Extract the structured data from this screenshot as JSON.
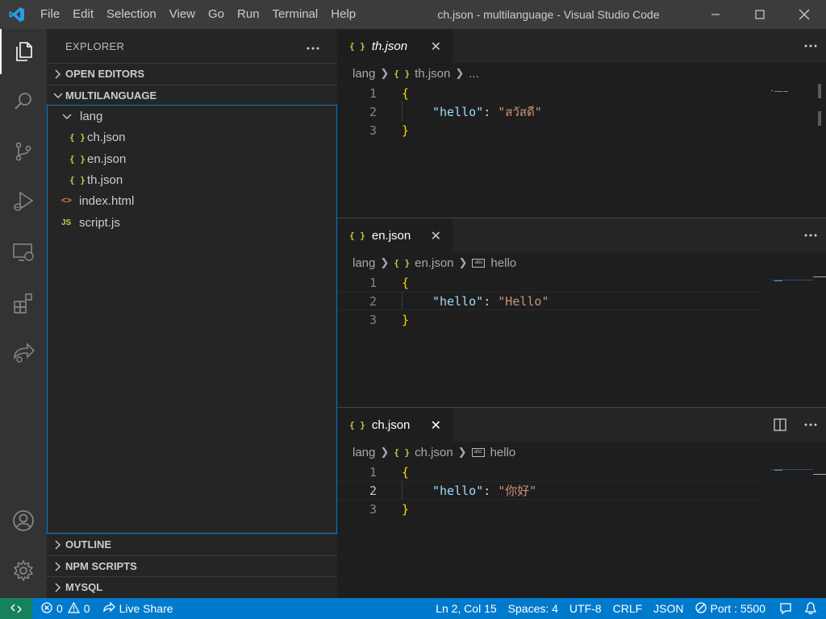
{
  "window": {
    "title": "ch.json - multilanguage - Visual Studio Code",
    "menu": [
      "File",
      "Edit",
      "Selection",
      "View",
      "Go",
      "Run",
      "Terminal",
      "Help"
    ]
  },
  "sidebar": {
    "header": "EXPLORER",
    "sections": {
      "open_editors": "OPEN EDITORS",
      "project": "MULTILANGUAGE",
      "outline": "OUTLINE",
      "npm_scripts": "NPM SCRIPTS",
      "mysql": "MYSQL"
    },
    "tree": {
      "folder": "lang",
      "lang_files": [
        "ch.json",
        "en.json",
        "th.json"
      ],
      "root_files": [
        "index.html",
        "script.js"
      ],
      "icon_json": "{ }",
      "icon_html": "<>",
      "icon_js": "JS"
    }
  },
  "editors": [
    {
      "tab": "th.json",
      "active": false,
      "breadcrumb": [
        "lang",
        "th.json",
        "..."
      ],
      "line_numbers": [
        "1",
        "2",
        "3"
      ],
      "lines": {
        "l1": "{",
        "key": "\"hello\"",
        "colon": ": ",
        "value": "\"สวัสดี\"",
        "l3": "}"
      }
    },
    {
      "tab": "en.json",
      "active": false,
      "breadcrumb": [
        "lang",
        "en.json",
        "hello"
      ],
      "line_numbers": [
        "1",
        "2",
        "3"
      ],
      "lines": {
        "l1": "{",
        "key": "\"hello\"",
        "colon": ": ",
        "value": "\"Hello\"",
        "l3": "}"
      }
    },
    {
      "tab": "ch.json",
      "active": true,
      "breadcrumb": [
        "lang",
        "ch.json",
        "hello"
      ],
      "line_numbers": [
        "1",
        "2",
        "3"
      ],
      "lines": {
        "l1": "{",
        "key": "\"hello\"",
        "colon": ": ",
        "value": "\"你好\"",
        "l3": "}"
      }
    }
  ],
  "statusbar": {
    "errors": "0",
    "warnings": "0",
    "live_share": "Live Share",
    "cursor": "Ln 2, Col 15",
    "spaces": "Spaces: 4",
    "encoding": "UTF-8",
    "eol": "CRLF",
    "language": "JSON",
    "port": "Port : 5500"
  },
  "colors": {
    "accent": "#007acc",
    "remote": "#16825d",
    "json_icon": "#cbcb41",
    "string": "#ce9178",
    "key": "#9cdcfe",
    "bracket": "#ffd700"
  }
}
